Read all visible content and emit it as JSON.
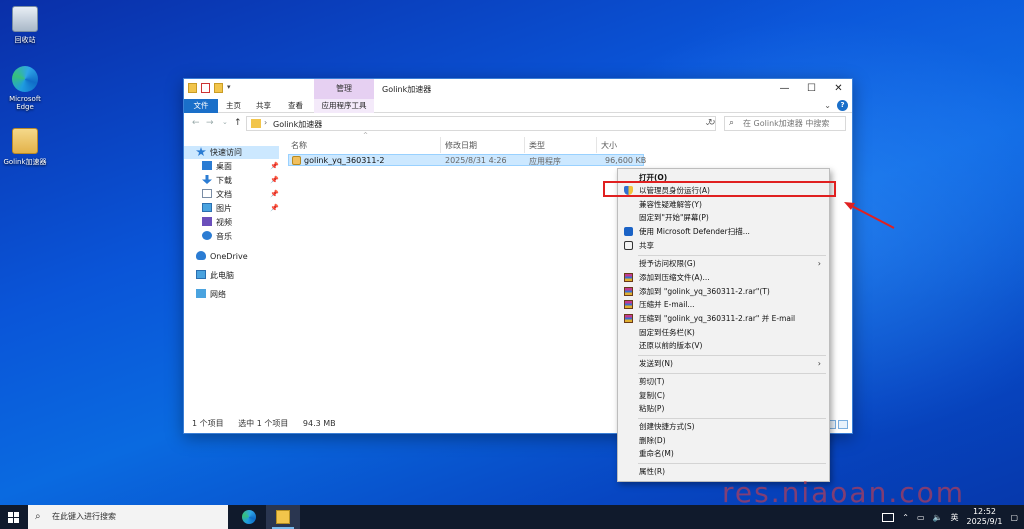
{
  "desktop": {
    "icons": [
      {
        "label": "回收站",
        "icon": "recycle-bin-icon"
      },
      {
        "label": "Microsoft Edge",
        "icon": "edge-icon"
      },
      {
        "label": "Golink加速器",
        "icon": "golink-icon"
      }
    ]
  },
  "window": {
    "title": "Golink加速器",
    "manage_tab": "管理",
    "ribbon_tabs": [
      "文件",
      "主页",
      "共享",
      "查看",
      "应用程序工具"
    ],
    "address_path": "Golink加速器",
    "search_placeholder": "在 Golink加速器 中搜索",
    "nav": [
      {
        "label": "快速访问",
        "icon": "star-icon"
      },
      {
        "label": "桌面",
        "icon": "desktop-icon"
      },
      {
        "label": "下载",
        "icon": "download-icon"
      },
      {
        "label": "文档",
        "icon": "documents-icon"
      },
      {
        "label": "图片",
        "icon": "pictures-icon"
      },
      {
        "label": "视频",
        "icon": "videos-icon"
      },
      {
        "label": "音乐",
        "icon": "music-icon"
      },
      {
        "label": "OneDrive",
        "icon": "onedrive-icon"
      },
      {
        "label": "此电脑",
        "icon": "this-pc-icon"
      },
      {
        "label": "网络",
        "icon": "network-icon"
      }
    ],
    "columns": [
      "名称",
      "修改日期",
      "类型",
      "大小"
    ],
    "file": {
      "name": "golink_yq_360311-2",
      "date": "2025/8/31 4:26",
      "type": "应用程序",
      "size": "96,600 KB"
    },
    "status": {
      "count": "1 个项目",
      "selected": "选中 1 个项目",
      "size": "94.3 MB"
    }
  },
  "context_menu": {
    "items": [
      "打开(O)",
      "以管理员身份运行(A)",
      "兼容性疑难解答(Y)",
      "固定到\"开始\"屏幕(P)",
      "使用 Microsoft Defender扫描...",
      "共享",
      "授予访问权限(G)",
      "添加到压缩文件(A)...",
      "添加到 \"golink_yq_360311-2.rar\"(T)",
      "压缩并 E-mail...",
      "压缩到 \"golink_yq_360311-2.rar\" 并 E-mail",
      "固定到任务栏(K)",
      "还原以前的版本(V)",
      "发送到(N)",
      "剪切(T)",
      "复制(C)",
      "粘贴(P)",
      "创建快捷方式(S)",
      "删除(D)",
      "重命名(M)",
      "属性(R)"
    ]
  },
  "watermark": "res.niaoan.com",
  "taskbar": {
    "search_placeholder": "在此键入进行搜索",
    "ime": "英",
    "time": "12:52",
    "date": "2025/9/1"
  },
  "colors": {
    "accent": "#1a6fc9",
    "highlight": "#e02020",
    "selection": "#cce8ff"
  }
}
